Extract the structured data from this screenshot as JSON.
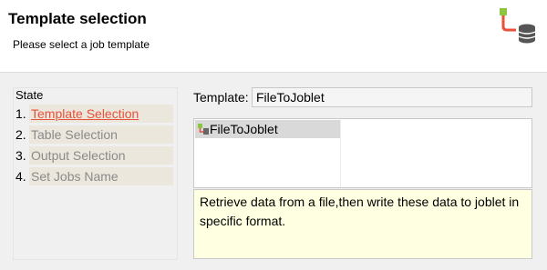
{
  "header": {
    "title": "Template selection",
    "subtitle": "Please select a job template",
    "icon": "wizard-database-icon"
  },
  "state": {
    "title": "State",
    "steps": [
      {
        "num": "1.",
        "label": "Template Selection",
        "active": true
      },
      {
        "num": "2.",
        "label": "Table Selection",
        "active": false
      },
      {
        "num": "3.",
        "label": "Output Selection",
        "active": false
      },
      {
        "num": "4.",
        "label": "Set Jobs Name",
        "active": false
      }
    ]
  },
  "template": {
    "label": "Template:",
    "value": "FileToJoblet"
  },
  "list": {
    "items": [
      {
        "label": "FileToJoblet",
        "icon": "joblet-icon",
        "selected": true
      }
    ]
  },
  "description": "Retrieve data from a file,then write these data to joblet in specific format.",
  "colors": {
    "active_step": "#e8503a",
    "step_bg": "#ebe7dc",
    "description_bg": "#ffffe1"
  }
}
